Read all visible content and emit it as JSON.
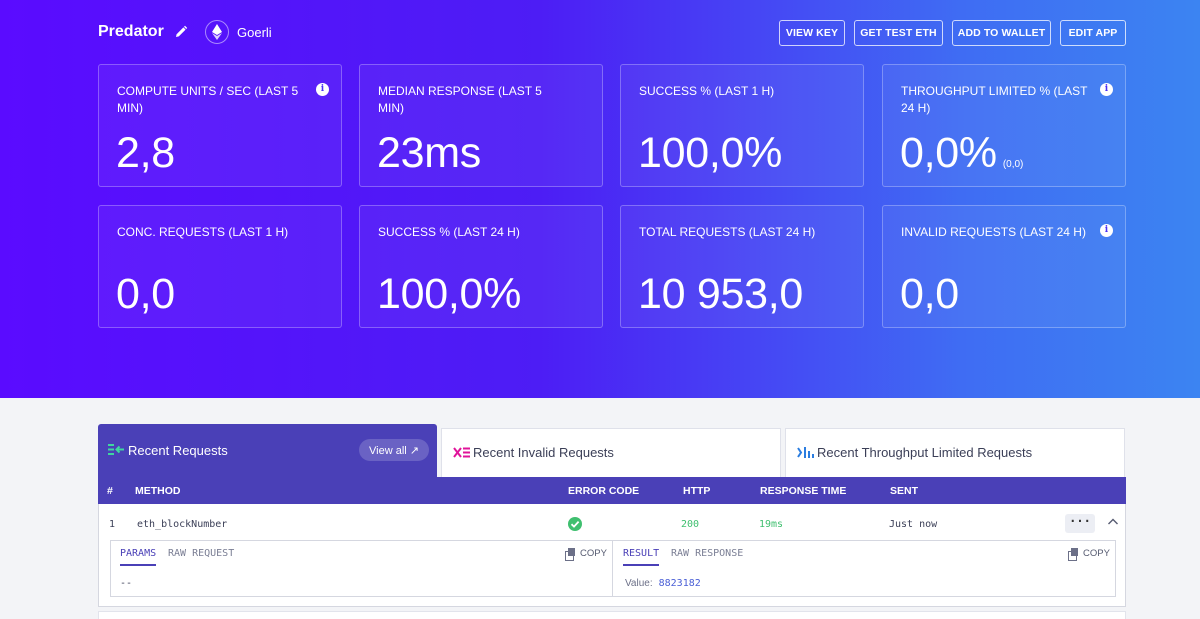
{
  "header": {
    "app_name": "Predator",
    "network": "Goerli",
    "buttons": {
      "view_key": "VIEW KEY",
      "get_test_eth": "GET TEST ETH",
      "add_to_wallet": "ADD TO WALLET",
      "edit_app": "EDIT APP"
    }
  },
  "stats": [
    {
      "label": "COMPUTE UNITS / SEC (LAST 5 MIN)",
      "value": "2,8",
      "sub": "",
      "info": true
    },
    {
      "label": "MEDIAN RESPONSE (LAST 5 MIN)",
      "value": "23ms",
      "sub": "",
      "info": false
    },
    {
      "label": "SUCCESS % (LAST 1 H)",
      "value": "100,0%",
      "sub": "",
      "info": false
    },
    {
      "label": "THROUGHPUT LIMITED % (LAST 24 H)",
      "value": "0,0%",
      "sub": "(0,0)",
      "info": true
    },
    {
      "label": "CONC. REQUESTS (LAST 1 H)",
      "value": "0,0",
      "sub": "",
      "info": false
    },
    {
      "label": "SUCCESS % (LAST 24 H)",
      "value": "100,0%",
      "sub": "",
      "info": false
    },
    {
      "label": "TOTAL REQUESTS (LAST 24 H)",
      "value": "10 953,0",
      "sub": "",
      "info": false
    },
    {
      "label": "INVALID REQUESTS (LAST 24 H)",
      "value": "0,0",
      "sub": "",
      "info": true
    }
  ],
  "tabs": {
    "recent": "Recent Requests",
    "view_all": "View all ↗",
    "invalid": "Recent Invalid Requests",
    "throughput": "Recent Throughput Limited Requests"
  },
  "table": {
    "columns": {
      "index": "#",
      "method": "METHOD",
      "error_code": "ERROR CODE",
      "http": "HTTP",
      "response_time": "RESPONSE TIME",
      "sent": "SENT"
    },
    "rows": [
      {
        "index": "1",
        "method": "eth_blockNumber",
        "http": "200",
        "response_time": "19ms",
        "sent": "Just now",
        "more": "···"
      }
    ]
  },
  "detail": {
    "left_tabs": {
      "params": "PARAMS",
      "raw_request": "RAW REQUEST"
    },
    "right_tabs": {
      "result": "RESULT",
      "raw_response": "RAW RESPONSE"
    },
    "copy": "COPY",
    "params_value": "--",
    "result_key": "Value:",
    "result_value": "8823182"
  },
  "colors": {
    "accent": "#4a40b7",
    "success": "#3fbf6f",
    "hero_start": "#5a0bff",
    "hero_end": "#3c84f2"
  }
}
